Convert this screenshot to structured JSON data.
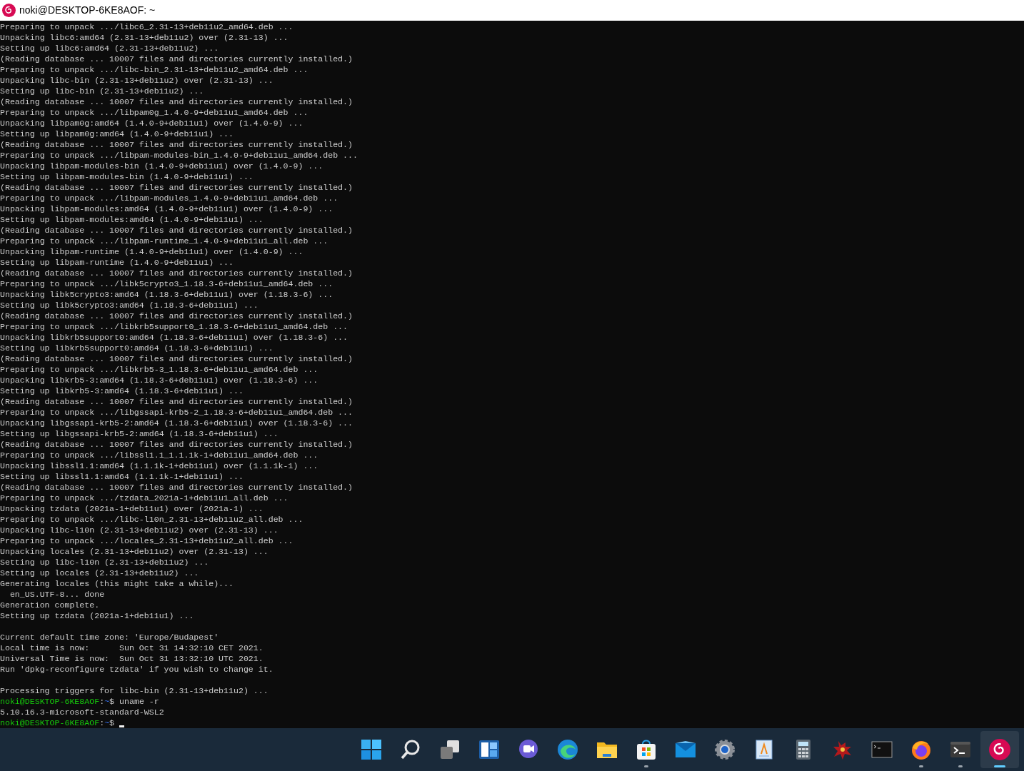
{
  "window": {
    "title": "noki@DESKTOP-6KE8AOF: ~"
  },
  "terminal": {
    "lines": [
      {
        "kind": "output",
        "text": "Preparing to unpack .../libc6_2.31-13+deb11u2_amd64.deb ..."
      },
      {
        "kind": "output",
        "text": "Unpacking libc6:amd64 (2.31-13+deb11u2) over (2.31-13) ..."
      },
      {
        "kind": "output",
        "text": "Setting up libc6:amd64 (2.31-13+deb11u2) ..."
      },
      {
        "kind": "output",
        "text": "(Reading database ... 10007 files and directories currently installed.)"
      },
      {
        "kind": "output",
        "text": "Preparing to unpack .../libc-bin_2.31-13+deb11u2_amd64.deb ..."
      },
      {
        "kind": "output",
        "text": "Unpacking libc-bin (2.31-13+deb11u2) over (2.31-13) ..."
      },
      {
        "kind": "output",
        "text": "Setting up libc-bin (2.31-13+deb11u2) ..."
      },
      {
        "kind": "output",
        "text": "(Reading database ... 10007 files and directories currently installed.)"
      },
      {
        "kind": "output",
        "text": "Preparing to unpack .../libpam0g_1.4.0-9+deb11u1_amd64.deb ..."
      },
      {
        "kind": "output",
        "text": "Unpacking libpam0g:amd64 (1.4.0-9+deb11u1) over (1.4.0-9) ..."
      },
      {
        "kind": "output",
        "text": "Setting up libpam0g:amd64 (1.4.0-9+deb11u1) ..."
      },
      {
        "kind": "output",
        "text": "(Reading database ... 10007 files and directories currently installed.)"
      },
      {
        "kind": "output",
        "text": "Preparing to unpack .../libpam-modules-bin_1.4.0-9+deb11u1_amd64.deb ..."
      },
      {
        "kind": "output",
        "text": "Unpacking libpam-modules-bin (1.4.0-9+deb11u1) over (1.4.0-9) ..."
      },
      {
        "kind": "output",
        "text": "Setting up libpam-modules-bin (1.4.0-9+deb11u1) ..."
      },
      {
        "kind": "output",
        "text": "(Reading database ... 10007 files and directories currently installed.)"
      },
      {
        "kind": "output",
        "text": "Preparing to unpack .../libpam-modules_1.4.0-9+deb11u1_amd64.deb ..."
      },
      {
        "kind": "output",
        "text": "Unpacking libpam-modules:amd64 (1.4.0-9+deb11u1) over (1.4.0-9) ..."
      },
      {
        "kind": "output",
        "text": "Setting up libpam-modules:amd64 (1.4.0-9+deb11u1) ..."
      },
      {
        "kind": "output",
        "text": "(Reading database ... 10007 files and directories currently installed.)"
      },
      {
        "kind": "output",
        "text": "Preparing to unpack .../libpam-runtime_1.4.0-9+deb11u1_all.deb ..."
      },
      {
        "kind": "output",
        "text": "Unpacking libpam-runtime (1.4.0-9+deb11u1) over (1.4.0-9) ..."
      },
      {
        "kind": "output",
        "text": "Setting up libpam-runtime (1.4.0-9+deb11u1) ..."
      },
      {
        "kind": "output",
        "text": "(Reading database ... 10007 files and directories currently installed.)"
      },
      {
        "kind": "output",
        "text": "Preparing to unpack .../libk5crypto3_1.18.3-6+deb11u1_amd64.deb ..."
      },
      {
        "kind": "output",
        "text": "Unpacking libk5crypto3:amd64 (1.18.3-6+deb11u1) over (1.18.3-6) ..."
      },
      {
        "kind": "output",
        "text": "Setting up libk5crypto3:amd64 (1.18.3-6+deb11u1) ..."
      },
      {
        "kind": "output",
        "text": "(Reading database ... 10007 files and directories currently installed.)"
      },
      {
        "kind": "output",
        "text": "Preparing to unpack .../libkrb5support0_1.18.3-6+deb11u1_amd64.deb ..."
      },
      {
        "kind": "output",
        "text": "Unpacking libkrb5support0:amd64 (1.18.3-6+deb11u1) over (1.18.3-6) ..."
      },
      {
        "kind": "output",
        "text": "Setting up libkrb5support0:amd64 (1.18.3-6+deb11u1) ..."
      },
      {
        "kind": "output",
        "text": "(Reading database ... 10007 files and directories currently installed.)"
      },
      {
        "kind": "output",
        "text": "Preparing to unpack .../libkrb5-3_1.18.3-6+deb11u1_amd64.deb ..."
      },
      {
        "kind": "output",
        "text": "Unpacking libkrb5-3:amd64 (1.18.3-6+deb11u1) over (1.18.3-6) ..."
      },
      {
        "kind": "output",
        "text": "Setting up libkrb5-3:amd64 (1.18.3-6+deb11u1) ..."
      },
      {
        "kind": "output",
        "text": "(Reading database ... 10007 files and directories currently installed.)"
      },
      {
        "kind": "output",
        "text": "Preparing to unpack .../libgssapi-krb5-2_1.18.3-6+deb11u1_amd64.deb ..."
      },
      {
        "kind": "output",
        "text": "Unpacking libgssapi-krb5-2:amd64 (1.18.3-6+deb11u1) over (1.18.3-6) ..."
      },
      {
        "kind": "output",
        "text": "Setting up libgssapi-krb5-2:amd64 (1.18.3-6+deb11u1) ..."
      },
      {
        "kind": "output",
        "text": "(Reading database ... 10007 files and directories currently installed.)"
      },
      {
        "kind": "output",
        "text": "Preparing to unpack .../libssl1.1_1.1.1k-1+deb11u1_amd64.deb ..."
      },
      {
        "kind": "output",
        "text": "Unpacking libssl1.1:amd64 (1.1.1k-1+deb11u1) over (1.1.1k-1) ..."
      },
      {
        "kind": "output",
        "text": "Setting up libssl1.1:amd64 (1.1.1k-1+deb11u1) ..."
      },
      {
        "kind": "output",
        "text": "(Reading database ... 10007 files and directories currently installed.)"
      },
      {
        "kind": "output",
        "text": "Preparing to unpack .../tzdata_2021a-1+deb11u1_all.deb ..."
      },
      {
        "kind": "output",
        "text": "Unpacking tzdata (2021a-1+deb11u1) over (2021a-1) ..."
      },
      {
        "kind": "output",
        "text": "Preparing to unpack .../libc-l10n_2.31-13+deb11u2_all.deb ..."
      },
      {
        "kind": "output",
        "text": "Unpacking libc-l10n (2.31-13+deb11u2) over (2.31-13) ..."
      },
      {
        "kind": "output",
        "text": "Preparing to unpack .../locales_2.31-13+deb11u2_all.deb ..."
      },
      {
        "kind": "output",
        "text": "Unpacking locales (2.31-13+deb11u2) over (2.31-13) ..."
      },
      {
        "kind": "output",
        "text": "Setting up libc-l10n (2.31-13+deb11u2) ..."
      },
      {
        "kind": "output",
        "text": "Setting up locales (2.31-13+deb11u2) ..."
      },
      {
        "kind": "output",
        "text": "Generating locales (this might take a while)..."
      },
      {
        "kind": "output",
        "text": "  en_US.UTF-8... done"
      },
      {
        "kind": "output",
        "text": "Generation complete."
      },
      {
        "kind": "output",
        "text": "Setting up tzdata (2021a-1+deb11u1) ..."
      },
      {
        "kind": "blank"
      },
      {
        "kind": "output",
        "text": "Current default time zone: 'Europe/Budapest'"
      },
      {
        "kind": "output",
        "text": "Local time is now:      Sun Oct 31 14:32:10 CET 2021."
      },
      {
        "kind": "output",
        "text": "Universal Time is now:  Sun Oct 31 13:32:10 UTC 2021."
      },
      {
        "kind": "output",
        "text": "Run 'dpkg-reconfigure tzdata' if you wish to change it."
      },
      {
        "kind": "blank"
      },
      {
        "kind": "output",
        "text": "Processing triggers for libc-bin (2.31-13+deb11u2) ..."
      },
      {
        "kind": "prompt",
        "user_host": "noki@DESKTOP-6KE8AOF",
        "separator": ":",
        "path": "~",
        "symbol": "$",
        "command": "uname -r",
        "cursor": false
      },
      {
        "kind": "output",
        "text": "5.10.16.3-microsoft-standard-WSL2"
      },
      {
        "kind": "prompt",
        "user_host": "noki@DESKTOP-6KE8AOF",
        "separator": ":",
        "path": "~",
        "symbol": "$",
        "cursor": true
      }
    ]
  },
  "taskbar": {
    "items": [
      {
        "kind": "start",
        "running": false,
        "selected": false
      },
      {
        "kind": "search",
        "running": false,
        "selected": false
      },
      {
        "kind": "taskview",
        "running": false,
        "selected": false
      },
      {
        "kind": "widgets",
        "running": false,
        "selected": false
      },
      {
        "kind": "chat",
        "running": false,
        "selected": false
      },
      {
        "kind": "browser",
        "running": false,
        "selected": false
      },
      {
        "kind": "folder",
        "running": false,
        "selected": false
      },
      {
        "kind": "store",
        "running": true,
        "selected": false
      },
      {
        "kind": "mail",
        "running": false,
        "selected": false
      },
      {
        "kind": "settings",
        "running": false,
        "selected": false
      },
      {
        "kind": "document",
        "running": false,
        "selected": false
      },
      {
        "kind": "calculator",
        "running": false,
        "selected": false
      },
      {
        "kind": "bug",
        "running": false,
        "selected": false
      },
      {
        "kind": "console",
        "running": false,
        "selected": false
      },
      {
        "kind": "foxbrowser",
        "running": true,
        "selected": false
      },
      {
        "kind": "terminal",
        "running": true,
        "selected": false
      },
      {
        "kind": "swirl",
        "running": true,
        "selected": true
      }
    ]
  }
}
